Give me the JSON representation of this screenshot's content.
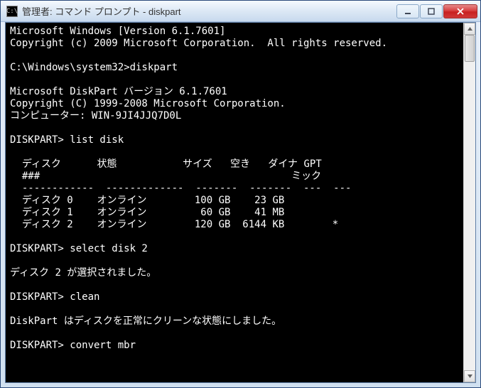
{
  "window": {
    "title": "管理者: コマンド プロンプト - diskpart",
    "icon_label": "C:\\"
  },
  "terminal": {
    "lines": [
      "Microsoft Windows [Version 6.1.7601]",
      "Copyright (c) 2009 Microsoft Corporation.  All rights reserved.",
      "",
      "C:\\Windows\\system32>diskpart",
      "",
      "Microsoft DiskPart バージョン 6.1.7601",
      "Copyright (C) 1999-2008 Microsoft Corporation.",
      "コンピューター: WIN-9JI4JJQ7D0L",
      "",
      "DISKPART> list disk",
      "",
      "  ディスク      状態           サイズ   空き   ダイナ GPT",
      "  ###                                          ミック",
      "  ------------  -------------  -------  -------  ---  ---",
      "  ディスク 0    オンライン        100 GB    23 GB",
      "  ディスク 1    オンライン         60 GB    41 MB",
      "  ディスク 2    オンライン        120 GB  6144 KB        *",
      "",
      "DISKPART> select disk 2",
      "",
      "ディスク 2 が選択されました。",
      "",
      "DISKPART> clean",
      "",
      "DiskPart はディスクを正常にクリーンな状態にしました。",
      "",
      "DISKPART> convert mbr"
    ]
  }
}
